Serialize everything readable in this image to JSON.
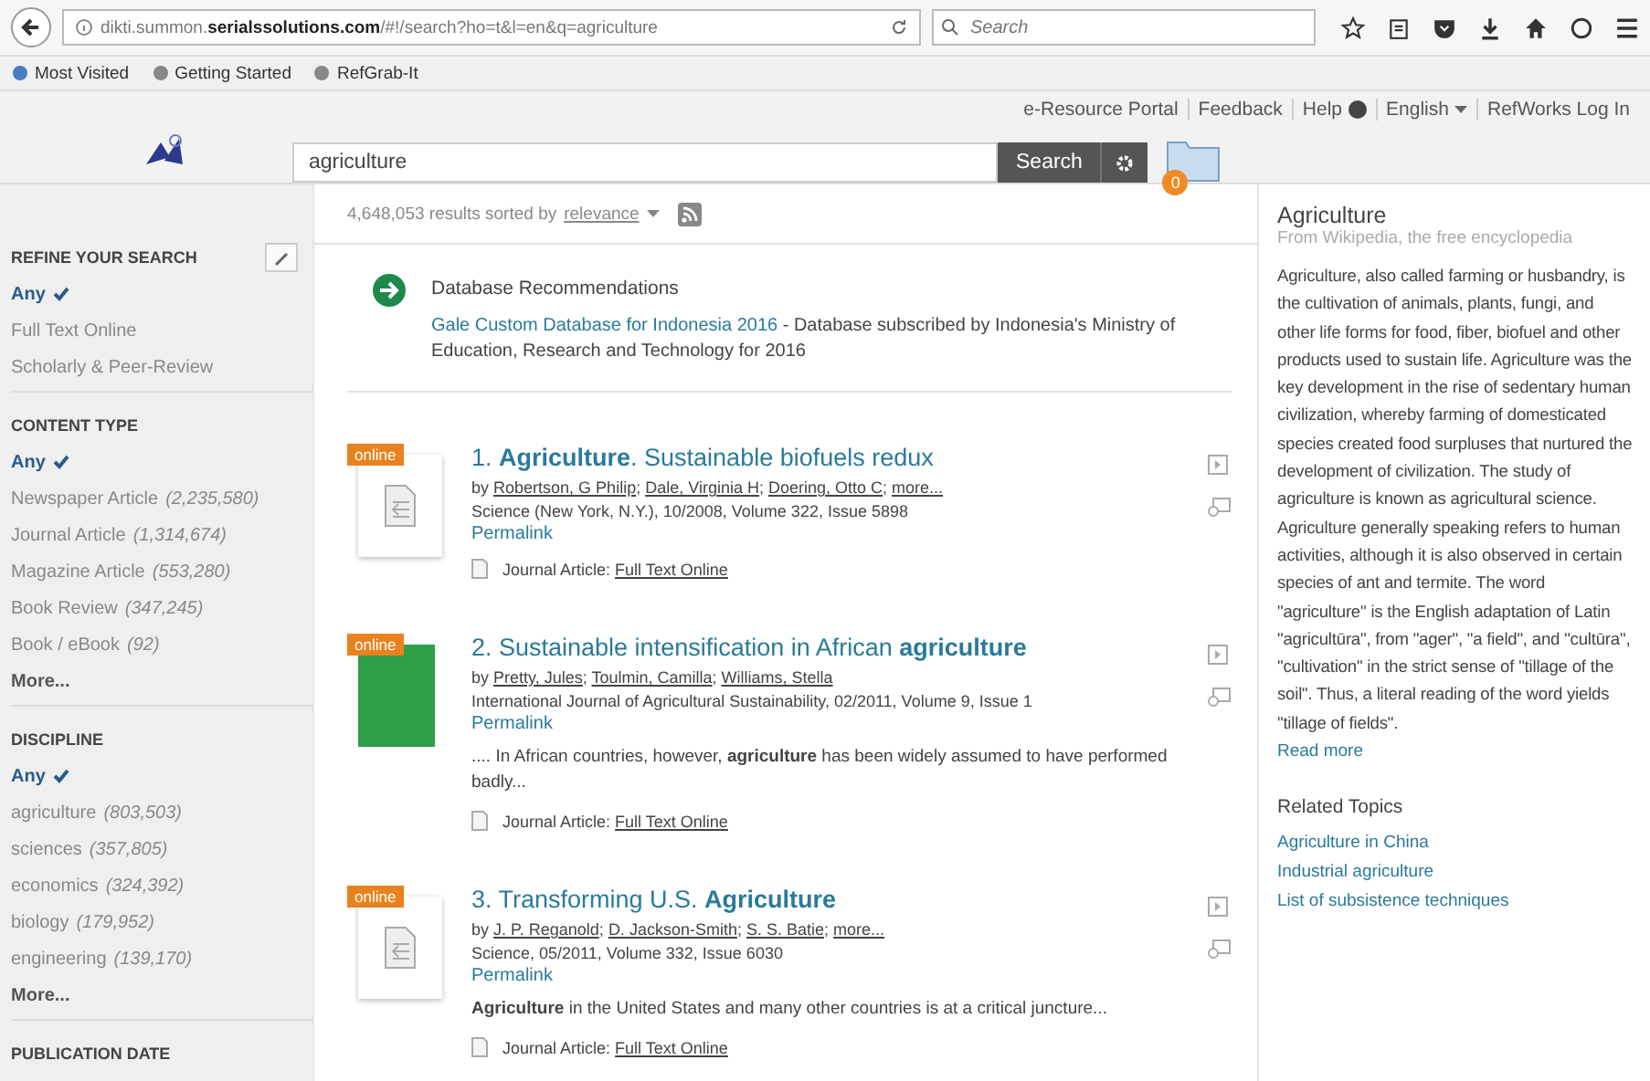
{
  "browser": {
    "url_prefix": "dikti.summon.",
    "url_domain": "serialssolutions.com",
    "url_path": "/#!/search?ho=t&l=en&q=agriculture",
    "search_placeholder": "Search"
  },
  "bookmarks": [
    "Most Visited",
    "Getting Started",
    "RefGrab-It"
  ],
  "header": {
    "links": [
      "e-Resource Portal",
      "Feedback",
      "Help",
      "English",
      "RefWorks Log In"
    ],
    "query": "agriculture",
    "search_button": "Search",
    "folder_count": "0"
  },
  "sidebar": {
    "sections": [
      {
        "title": "REFINE YOUR SEARCH",
        "items": [
          {
            "label": "Any",
            "selected": true
          },
          {
            "label": "Full Text Online",
            "selected": false
          },
          {
            "label": "Scholarly & Peer-Review",
            "selected": false
          }
        ]
      },
      {
        "title": "CONTENT TYPE",
        "items": [
          {
            "label": "Any",
            "selected": true
          },
          {
            "label": "Newspaper Article",
            "count": "(2,235,580)",
            "selected": false
          },
          {
            "label": "Journal Article",
            "count": "(1,314,674)",
            "selected": false
          },
          {
            "label": "Magazine Article",
            "count": "(553,280)",
            "selected": false
          },
          {
            "label": "Book Review",
            "count": "(347,245)",
            "selected": false
          },
          {
            "label": "Book / eBook",
            "count": "(92)",
            "selected": false
          }
        ],
        "more": "More..."
      },
      {
        "title": "DISCIPLINE",
        "items": [
          {
            "label": "Any",
            "selected": true
          },
          {
            "label": "agriculture",
            "count": "(803,503)",
            "selected": false
          },
          {
            "label": "sciences",
            "count": "(357,805)",
            "selected": false
          },
          {
            "label": "economics",
            "count": "(324,392)",
            "selected": false
          },
          {
            "label": "biology",
            "count": "(179,952)",
            "selected": false
          },
          {
            "label": "engineering",
            "count": "(139,170)",
            "selected": false
          }
        ],
        "more": "More..."
      },
      {
        "title": "PUBLICATION DATE"
      }
    ]
  },
  "results_summary": {
    "count_text": "4,648,053 results sorted by",
    "sort": "relevance"
  },
  "recommendation": {
    "title": "Database Recommendations",
    "link": "Gale Custom Database for Indonesia 2016",
    "text": "- Database subscribed by Indonesia's Ministry of Education, Research and Technology for 2016"
  },
  "results": [
    {
      "badge": "online",
      "kind": "document",
      "title": "1. **Agriculture**. Sustainable biofuels redux",
      "by": "by",
      "authors": [
        {
          "name": "Robertson, G Philip",
          "sep": ";"
        },
        {
          "name": "Dale, Virginia H",
          "sep": ";"
        },
        {
          "name": "Doering, Otto C",
          "sep": ";"
        },
        {
          "name": "more..."
        }
      ],
      "source": "Science (New York, N.Y.), 10/2008, Volume 322, Issue 5898",
      "permalink": "Permalink",
      "format": "Journal Article:",
      "fulltext": "Full Text Online"
    },
    {
      "badge": "online",
      "kind": "cover",
      "title": "2. Sustainable intensification in African **agriculture**",
      "by": "by",
      "authors": [
        {
          "name": "Pretty, Jules",
          "sep": ";"
        },
        {
          "name": "Toulmin, Camilla",
          "sep": ";"
        },
        {
          "name": "Williams, Stella"
        }
      ],
      "source": "International Journal of Agricultural Sustainability, 02/2011, Volume 9, Issue 1",
      "permalink": "Permalink",
      "snippet": ".... In African countries, however, **agriculture** has been widely assumed to have performed badly...",
      "format": "Journal Article:",
      "fulltext": "Full Text Online"
    },
    {
      "badge": "online",
      "kind": "document",
      "title": "3. Transforming U.S. **Agriculture**",
      "by": "by",
      "authors": [
        {
          "name": "J. P. Reganold",
          "sep": ";"
        },
        {
          "name": "D. Jackson-Smith",
          "sep": ";"
        },
        {
          "name": "S. S. Batie",
          "sep": ";"
        },
        {
          "name": "more..."
        }
      ],
      "source": "Science, 05/2011, Volume 332, Issue 6030",
      "permalink": "Permalink",
      "snippet": "**Agriculture** in the United States and many other countries is at a critical juncture...",
      "format": "Journal Article:",
      "fulltext": "Full Text Online"
    }
  ],
  "topic": {
    "title": "Agriculture",
    "source": "From Wikipedia, the free encyclopedia",
    "text": "Agriculture, also called farming or husbandry, is the cultivation of animals, plants, fungi, and other life forms for food, fiber, biofuel and other products used to sustain life. Agriculture was the key development in the rise of sedentary human civilization, whereby farming of domesticated species created food surpluses that nurtured the development of civilization. The study of agriculture is known as agricultural science. Agriculture generally speaking refers to human activities, although it is also observed in certain species of ant and termite. The word \"agriculture\" is the English adaptation of Latin \"agricultūra\", from \"ager\", \"a field\", and \"cultūra\", \"cultivation\" in the strict sense of \"tillage of the soil\". Thus, a literal reading of the word yields \"tillage of fields\".",
    "read_more": "Read more",
    "related_title": "Related Topics",
    "related": [
      "Agriculture in China",
      "Industrial agriculture",
      "List of subsistence techniques"
    ]
  }
}
